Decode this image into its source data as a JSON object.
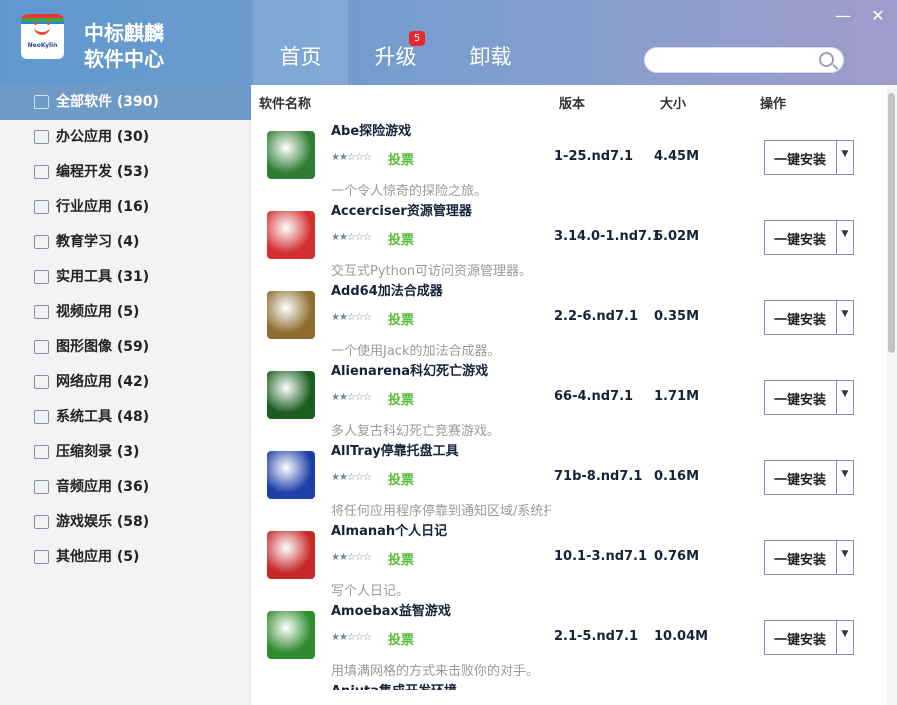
{
  "brand": {
    "line1": "中标麒麟",
    "line2": "软件中心",
    "logo_text": "NeoKylin"
  },
  "nav": [
    {
      "label": "首页"
    },
    {
      "label": "升级",
      "badge": "5"
    },
    {
      "label": "卸载"
    }
  ],
  "window": {
    "minimize_glyph": "—",
    "close_glyph": "✕"
  },
  "search": {
    "value": "",
    "placeholder": ""
  },
  "sidebar": {
    "items": [
      {
        "label": "全部软件 (390)",
        "icon": "grid-icon",
        "active": true
      },
      {
        "label": "办公应用 (30)",
        "icon": "briefcase-icon"
      },
      {
        "label": "编程开发 (53)",
        "icon": "code-icon"
      },
      {
        "label": "行业应用 (16)",
        "icon": "chart-icon"
      },
      {
        "label": "教育学习 (4)",
        "icon": "graduation-cap-icon"
      },
      {
        "label": "实用工具 (31)",
        "icon": "tools-icon"
      },
      {
        "label": "视频应用 (5)",
        "icon": "film-icon"
      },
      {
        "label": "图形图像 (59)",
        "icon": "image-icon"
      },
      {
        "label": "网络应用 (42)",
        "icon": "globe-icon"
      },
      {
        "label": "系统工具 (48)",
        "icon": "gear-icon"
      },
      {
        "label": "压缩刻录 (3)",
        "icon": "archive-icon"
      },
      {
        "label": "音频应用 (36)",
        "icon": "music-note-icon"
      },
      {
        "label": "游戏娱乐 (58)",
        "icon": "gamepad-icon"
      },
      {
        "label": "其他应用 (5)",
        "icon": "apps-icon"
      }
    ]
  },
  "table": {
    "headers": {
      "name": "软件名称",
      "version": "版本",
      "size": "大小",
      "action": "操作"
    },
    "vote_label": "投票",
    "install_label": "一键安装",
    "stars_text": "★★☆☆☆",
    "rows": [
      {
        "name": "Abe探险游戏",
        "desc": "一个令人惊奇的探险之旅。",
        "version": "1-25.nd7.1",
        "size": "4.45M",
        "icon": "abe-game-icon",
        "color": "#2e7d32"
      },
      {
        "name": "Accerciser资源管理器",
        "desc": "交互式Python可访问资源管理器。",
        "version": "3.14.0-1.nd7.1",
        "size": "6.02M",
        "icon": "dumbbell-icon",
        "color": "#d32f2f"
      },
      {
        "name": "Add64加法合成器",
        "desc": "一个使用Jack的加法合成器。",
        "version": "2.2-6.nd7.1",
        "size": "0.35M",
        "icon": "synth-icon",
        "color": "#8d6e2f"
      },
      {
        "name": "Alienarena科幻死亡游戏",
        "desc": "多人复古科幻死亡竞赛游戏。",
        "version": "66-4.nd7.1",
        "size": "1.71M",
        "icon": "alien-icon",
        "color": "#1b5e20"
      },
      {
        "name": "AllTray停靠托盘工具",
        "desc": "将任何应用程序停靠到通知区域/系统托盘。",
        "version": "71b-8.nd7.1",
        "size": "0.16M",
        "icon": "alltray-icon",
        "color": "#1e3fa8"
      },
      {
        "name": "Almanah个人日记",
        "desc": "写个人日记。",
        "version": "10.1-3.nd7.1",
        "size": "0.76M",
        "icon": "diary-icon",
        "color": "#c62828"
      },
      {
        "name": "Amoebax益智游戏",
        "desc": "用填满网格的方式来击败你的对手。",
        "version": "2.1-5.nd7.1",
        "size": "10.04M",
        "icon": "amoeba-icon",
        "color": "#2e8b2e"
      },
      {
        "name": "Anjuta集成开发环境",
        "desc": "",
        "version": "",
        "size": "",
        "icon": "anjuta-icon",
        "color": "#555555"
      }
    ]
  },
  "colors": {
    "accent": "#6d9bc6",
    "vote": "#5aba3a",
    "badge": "#e8282b",
    "button_border": "#8f86c2"
  }
}
